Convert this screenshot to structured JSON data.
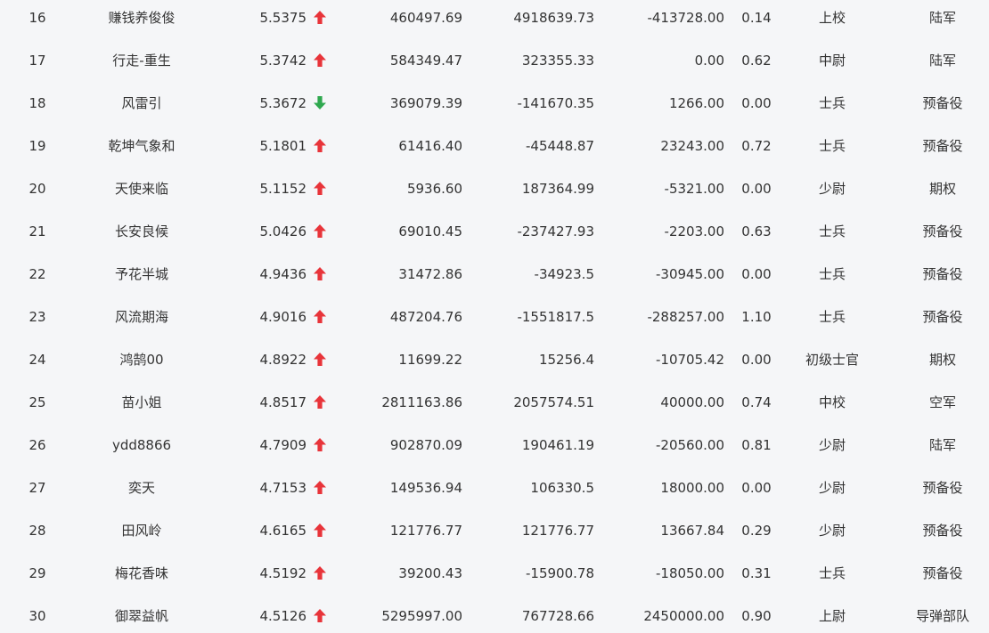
{
  "colors": {
    "up": "#e8343a",
    "down": "#2fa84f",
    "text": "#333333",
    "background": "#f5f6f8"
  },
  "rows": [
    {
      "rank": "16",
      "name": "赚钱养俊俊",
      "score": "5.5375",
      "trend": "up",
      "col_a": "460497.69",
      "col_b": "4918639.73",
      "col_c": "-413728.00",
      "ratio": "0.14",
      "military_rank": "上校",
      "branch": "陆军"
    },
    {
      "rank": "17",
      "name": "行走-重生",
      "score": "5.3742",
      "trend": "up",
      "col_a": "584349.47",
      "col_b": "323355.33",
      "col_c": "0.00",
      "ratio": "0.62",
      "military_rank": "中尉",
      "branch": "陆军"
    },
    {
      "rank": "18",
      "name": "风雷引",
      "score": "5.3672",
      "trend": "down",
      "col_a": "369079.39",
      "col_b": "-141670.35",
      "col_c": "1266.00",
      "ratio": "0.00",
      "military_rank": "士兵",
      "branch": "预备役"
    },
    {
      "rank": "19",
      "name": "乾坤气象和",
      "score": "5.1801",
      "trend": "up",
      "col_a": "61416.40",
      "col_b": "-45448.87",
      "col_c": "23243.00",
      "ratio": "0.72",
      "military_rank": "士兵",
      "branch": "预备役"
    },
    {
      "rank": "20",
      "name": "天使来临",
      "score": "5.1152",
      "trend": "up",
      "col_a": "5936.60",
      "col_b": "187364.99",
      "col_c": "-5321.00",
      "ratio": "0.00",
      "military_rank": "少尉",
      "branch": "期权"
    },
    {
      "rank": "21",
      "name": "长安良候",
      "score": "5.0426",
      "trend": "up",
      "col_a": "69010.45",
      "col_b": "-237427.93",
      "col_c": "-2203.00",
      "ratio": "0.63",
      "military_rank": "士兵",
      "branch": "预备役"
    },
    {
      "rank": "22",
      "name": "予花半城",
      "score": "4.9436",
      "trend": "up",
      "col_a": "31472.86",
      "col_b": "-34923.5",
      "col_c": "-30945.00",
      "ratio": "0.00",
      "military_rank": "士兵",
      "branch": "预备役"
    },
    {
      "rank": "23",
      "name": "风流期海",
      "score": "4.9016",
      "trend": "up",
      "col_a": "487204.76",
      "col_b": "-1551817.5",
      "col_c": "-288257.00",
      "ratio": "1.10",
      "military_rank": "士兵",
      "branch": "预备役"
    },
    {
      "rank": "24",
      "name": "鸿鹄00",
      "score": "4.8922",
      "trend": "up",
      "col_a": "11699.22",
      "col_b": "15256.4",
      "col_c": "-10705.42",
      "ratio": "0.00",
      "military_rank": "初级士官",
      "branch": "期权"
    },
    {
      "rank": "25",
      "name": "苗小姐",
      "score": "4.8517",
      "trend": "up",
      "col_a": "2811163.86",
      "col_b": "2057574.51",
      "col_c": "40000.00",
      "ratio": "0.74",
      "military_rank": "中校",
      "branch": "空军"
    },
    {
      "rank": "26",
      "name": "ydd8866",
      "score": "4.7909",
      "trend": "up",
      "col_a": "902870.09",
      "col_b": "190461.19",
      "col_c": "-20560.00",
      "ratio": "0.81",
      "military_rank": "少尉",
      "branch": "陆军"
    },
    {
      "rank": "27",
      "name": "奕天",
      "score": "4.7153",
      "trend": "up",
      "col_a": "149536.94",
      "col_b": "106330.5",
      "col_c": "18000.00",
      "ratio": "0.00",
      "military_rank": "少尉",
      "branch": "预备役"
    },
    {
      "rank": "28",
      "name": "田风岭",
      "score": "4.6165",
      "trend": "up",
      "col_a": "121776.77",
      "col_b": "121776.77",
      "col_c": "13667.84",
      "ratio": "0.29",
      "military_rank": "少尉",
      "branch": "预备役"
    },
    {
      "rank": "29",
      "name": "梅花香味",
      "score": "4.5192",
      "trend": "up",
      "col_a": "39200.43",
      "col_b": "-15900.78",
      "col_c": "-18050.00",
      "ratio": "0.31",
      "military_rank": "士兵",
      "branch": "预备役"
    },
    {
      "rank": "30",
      "name": "御翠益帆",
      "score": "4.5126",
      "trend": "up",
      "col_a": "5295997.00",
      "col_b": "767728.66",
      "col_c": "2450000.00",
      "ratio": "0.90",
      "military_rank": "上尉",
      "branch": "导弹部队"
    }
  ]
}
